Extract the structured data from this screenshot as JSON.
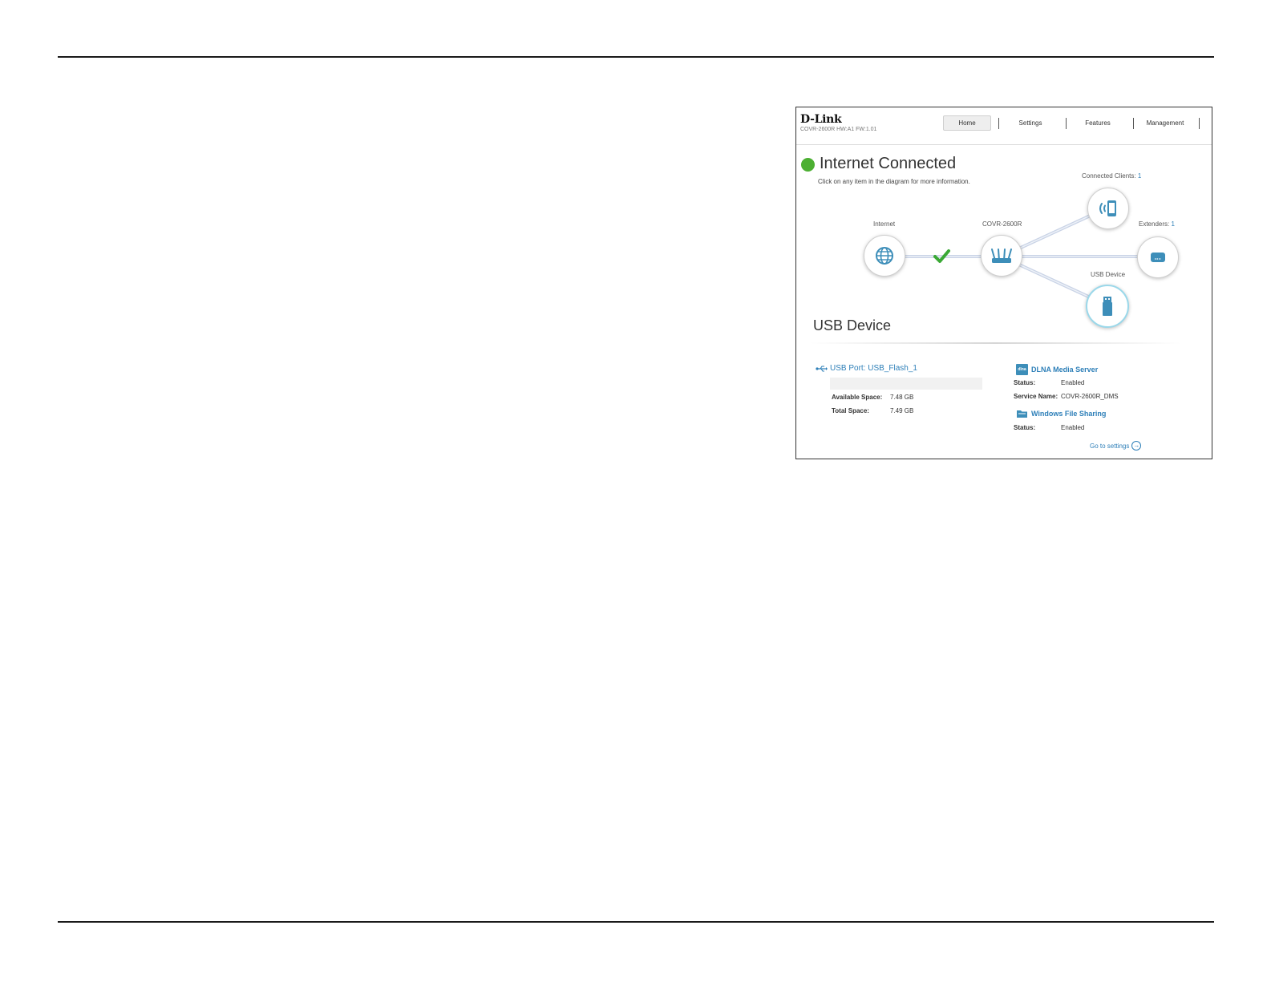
{
  "header": {
    "logo": "D-Link",
    "model_info": "COVR-2600R HW:A1 FW:1.01",
    "nav": [
      "Home",
      "Settings",
      "Features",
      "Management"
    ]
  },
  "status": {
    "title": "Internet Connected",
    "subtitle": "Click on any item in the diagram for more information."
  },
  "diagram": {
    "internet_label": "Internet",
    "router_label": "COVR-2600R",
    "clients_label": "Connected Clients:",
    "clients_count": "1",
    "extenders_label": "Extenders:",
    "extenders_count": "1",
    "usb_label": "USB Device"
  },
  "usb": {
    "section_title": "USB Device",
    "port": "USB Port: USB_Flash_1",
    "available_label": "Available Space:",
    "available_value": "7.48 GB",
    "total_label": "Total Space:",
    "total_value": "7.49 GB"
  },
  "dlna": {
    "icon_text": "dlna",
    "title": "DLNA Media Server",
    "status_label": "Status:",
    "status_value": "Enabled",
    "service_label": "Service Name:",
    "service_value": "COVR-2600R_DMS"
  },
  "wfs": {
    "title": "Windows File Sharing",
    "status_label": "Status:",
    "status_value": "Enabled"
  },
  "go_to_settings": "Go to settings",
  "colors": {
    "accent": "#2d7fb8",
    "icon_teal": "#3d8eb9",
    "status_green": "#4caf32",
    "line": "#cfd8ea"
  }
}
